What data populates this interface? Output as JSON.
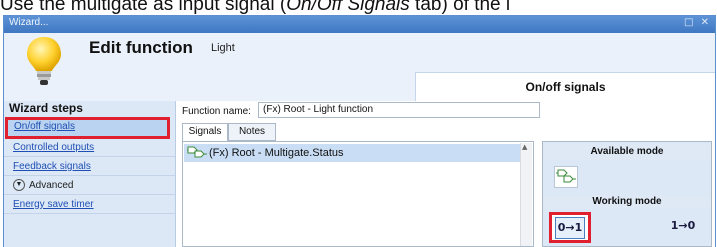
{
  "caption": {
    "prefix": "Use the multigate as input signal (",
    "emph": "On/Off Signals",
    "suffix": " tab) of the l"
  },
  "window": {
    "title": "Wizard...",
    "controls": "□ ✕"
  },
  "header": {
    "title": "Edit function",
    "subtitle": "Light",
    "tab_label": "On/off signals"
  },
  "sidebar": {
    "title": "Wizard steps",
    "items": [
      {
        "label": "On/off signals",
        "selected": true
      },
      {
        "label": "Controlled outputs"
      },
      {
        "label": "Feedback signals"
      },
      {
        "label": "Advanced"
      },
      {
        "label": "Energy save timer"
      }
    ]
  },
  "form": {
    "function_name_label": "Function name:",
    "function_name_value": "(Fx) Root - Light function"
  },
  "tabs": [
    {
      "label": "Signals",
      "active": true
    },
    {
      "label": "Notes"
    }
  ],
  "signals": [
    {
      "label": "(Fx) Root - Multigate.Status",
      "icon": "multigate-icon"
    }
  ],
  "modes": {
    "available_title": "Available mode",
    "working_title": "Working mode",
    "buttons": [
      {
        "label": "0→1",
        "selected": true
      },
      {
        "label": "1→0"
      }
    ]
  },
  "colors": {
    "accent": "#3f77c2",
    "highlight": "#e0202e",
    "selection": "#c9def4"
  }
}
